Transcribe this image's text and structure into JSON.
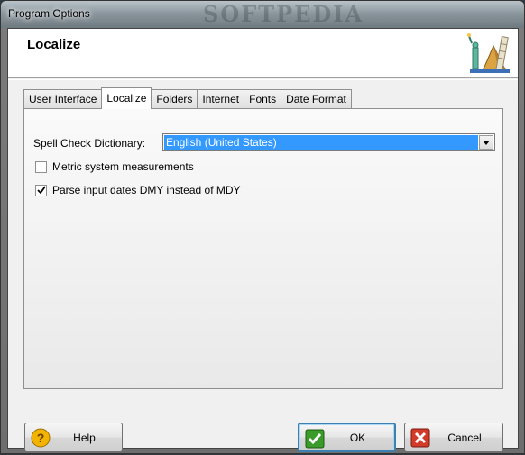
{
  "window": {
    "title": "Program Options",
    "watermark": "SOFTPEDIA"
  },
  "header": {
    "title": "Localize",
    "icon": "world-landmarks-icon"
  },
  "tabs": [
    {
      "label": "User Interface",
      "active": false
    },
    {
      "label": "Localize",
      "active": true
    },
    {
      "label": "Folders",
      "active": false
    },
    {
      "label": "Internet",
      "active": false
    },
    {
      "label": "Fonts",
      "active": false
    },
    {
      "label": "Date Format",
      "active": false
    }
  ],
  "localize": {
    "spell_check_label": "Spell Check Dictionary:",
    "spell_check_value": "English (United States)",
    "metric_label": "Metric system measurements",
    "metric_checked": false,
    "parse_dates_label": "Parse input dates DMY instead of MDY",
    "parse_dates_checked": true
  },
  "buttons": {
    "help": {
      "label": "Help",
      "icon": "help-question-icon"
    },
    "ok": {
      "label": "OK",
      "icon": "green-check-icon"
    },
    "cancel": {
      "label": "Cancel",
      "icon": "red-x-icon"
    }
  },
  "colors": {
    "selection": "#3399ff",
    "ok_icon": "#3a9a2a",
    "cancel_icon": "#d23a2a",
    "help_icon": "#f2b400"
  }
}
